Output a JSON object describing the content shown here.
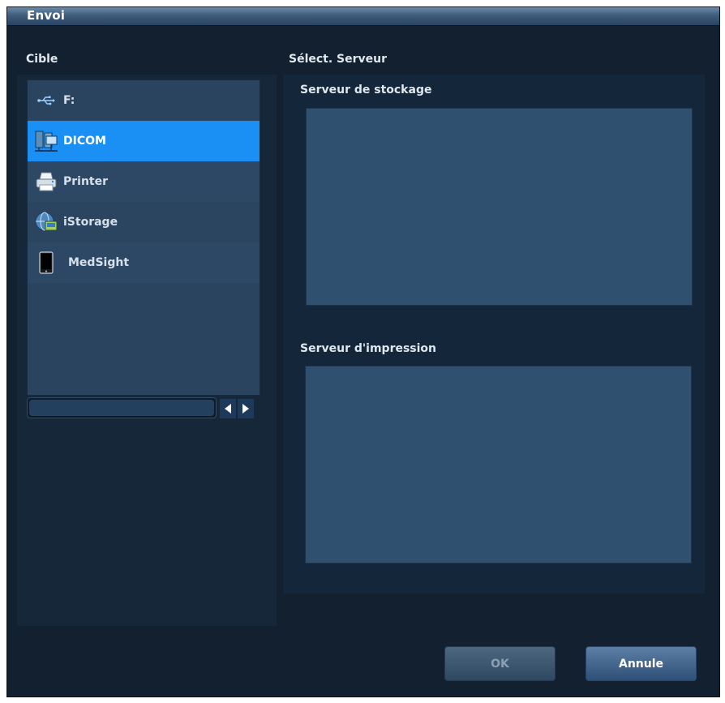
{
  "window": {
    "title": "Envoi"
  },
  "target": {
    "label": "Cible",
    "items": [
      {
        "label": "F:",
        "icon": "usb-icon"
      },
      {
        "label": "DICOM",
        "icon": "dicom-network-icon",
        "selected": true
      },
      {
        "label": "Printer",
        "icon": "printer-icon"
      },
      {
        "label": "iStorage",
        "icon": "istorage-globe-icon"
      },
      {
        "label": "MedSight",
        "icon": "tablet-icon"
      }
    ]
  },
  "server": {
    "label": "Sélect. Serveur",
    "storage_label": "Serveur de stockage",
    "print_label": "Serveur d'impression"
  },
  "buttons": {
    "ok": "OK",
    "cancel": "Annule"
  },
  "colors": {
    "background": "#13202f",
    "selected": "#1a8ff4",
    "list_bg": "#2a4460",
    "server_box": "#30506f"
  }
}
